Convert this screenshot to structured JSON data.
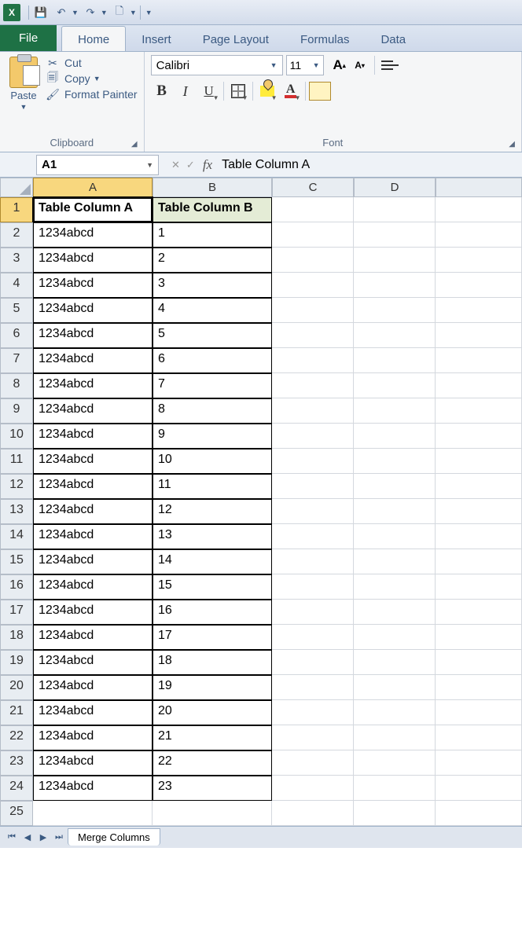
{
  "qat": {
    "save": "💾",
    "undo": "↶",
    "redo": "↷"
  },
  "tabs": {
    "file": "File",
    "home": "Home",
    "insert": "Insert",
    "page_layout": "Page Layout",
    "formulas": "Formulas",
    "data": "Data"
  },
  "ribbon": {
    "clipboard": {
      "paste": "Paste",
      "cut": "Cut",
      "copy": "Copy",
      "format_painter": "Format Painter",
      "label": "Clipboard"
    },
    "font": {
      "name": "Calibri",
      "size": "11",
      "bold": "B",
      "italic": "I",
      "underline": "U",
      "grow": "A",
      "shrink": "A",
      "fontcolor_letter": "A",
      "label": "Font"
    }
  },
  "namebox": "A1",
  "fx": "fx",
  "formula": "Table Column A",
  "columns": [
    "A",
    "B",
    "C",
    "D"
  ],
  "table": {
    "headers": [
      "Table Column A",
      "Table Column B"
    ],
    "rows": [
      [
        "1234abcd",
        "1"
      ],
      [
        "1234abcd",
        "2"
      ],
      [
        "1234abcd",
        "3"
      ],
      [
        "1234abcd",
        "4"
      ],
      [
        "1234abcd",
        "5"
      ],
      [
        "1234abcd",
        "6"
      ],
      [
        "1234abcd",
        "7"
      ],
      [
        "1234abcd",
        "8"
      ],
      [
        "1234abcd",
        "9"
      ],
      [
        "1234abcd",
        "10"
      ],
      [
        "1234abcd",
        "11"
      ],
      [
        "1234abcd",
        "12"
      ],
      [
        "1234abcd",
        "13"
      ],
      [
        "1234abcd",
        "14"
      ],
      [
        "1234abcd",
        "15"
      ],
      [
        "1234abcd",
        "16"
      ],
      [
        "1234abcd",
        "17"
      ],
      [
        "1234abcd",
        "18"
      ],
      [
        "1234abcd",
        "19"
      ],
      [
        "1234abcd",
        "20"
      ],
      [
        "1234abcd",
        "21"
      ],
      [
        "1234abcd",
        "22"
      ],
      [
        "1234abcd",
        "23"
      ]
    ]
  },
  "row_numbers": [
    "1",
    "2",
    "3",
    "4",
    "5",
    "6",
    "7",
    "8",
    "9",
    "10",
    "11",
    "12",
    "13",
    "14",
    "15",
    "16",
    "17",
    "18",
    "19",
    "20",
    "21",
    "22",
    "23",
    "24",
    "25"
  ],
  "sheet": {
    "name": "Merge Columns"
  },
  "chart_data": {
    "type": "table",
    "headers": [
      "Table Column A",
      "Table Column B"
    ],
    "rows": [
      [
        "1234abcd",
        1
      ],
      [
        "1234abcd",
        2
      ],
      [
        "1234abcd",
        3
      ],
      [
        "1234abcd",
        4
      ],
      [
        "1234abcd",
        5
      ],
      [
        "1234abcd",
        6
      ],
      [
        "1234abcd",
        7
      ],
      [
        "1234abcd",
        8
      ],
      [
        "1234abcd",
        9
      ],
      [
        "1234abcd",
        10
      ],
      [
        "1234abcd",
        11
      ],
      [
        "1234abcd",
        12
      ],
      [
        "1234abcd",
        13
      ],
      [
        "1234abcd",
        14
      ],
      [
        "1234abcd",
        15
      ],
      [
        "1234abcd",
        16
      ],
      [
        "1234abcd",
        17
      ],
      [
        "1234abcd",
        18
      ],
      [
        "1234abcd",
        19
      ],
      [
        "1234abcd",
        20
      ],
      [
        "1234abcd",
        21
      ],
      [
        "1234abcd",
        22
      ],
      [
        "1234abcd",
        23
      ]
    ]
  }
}
